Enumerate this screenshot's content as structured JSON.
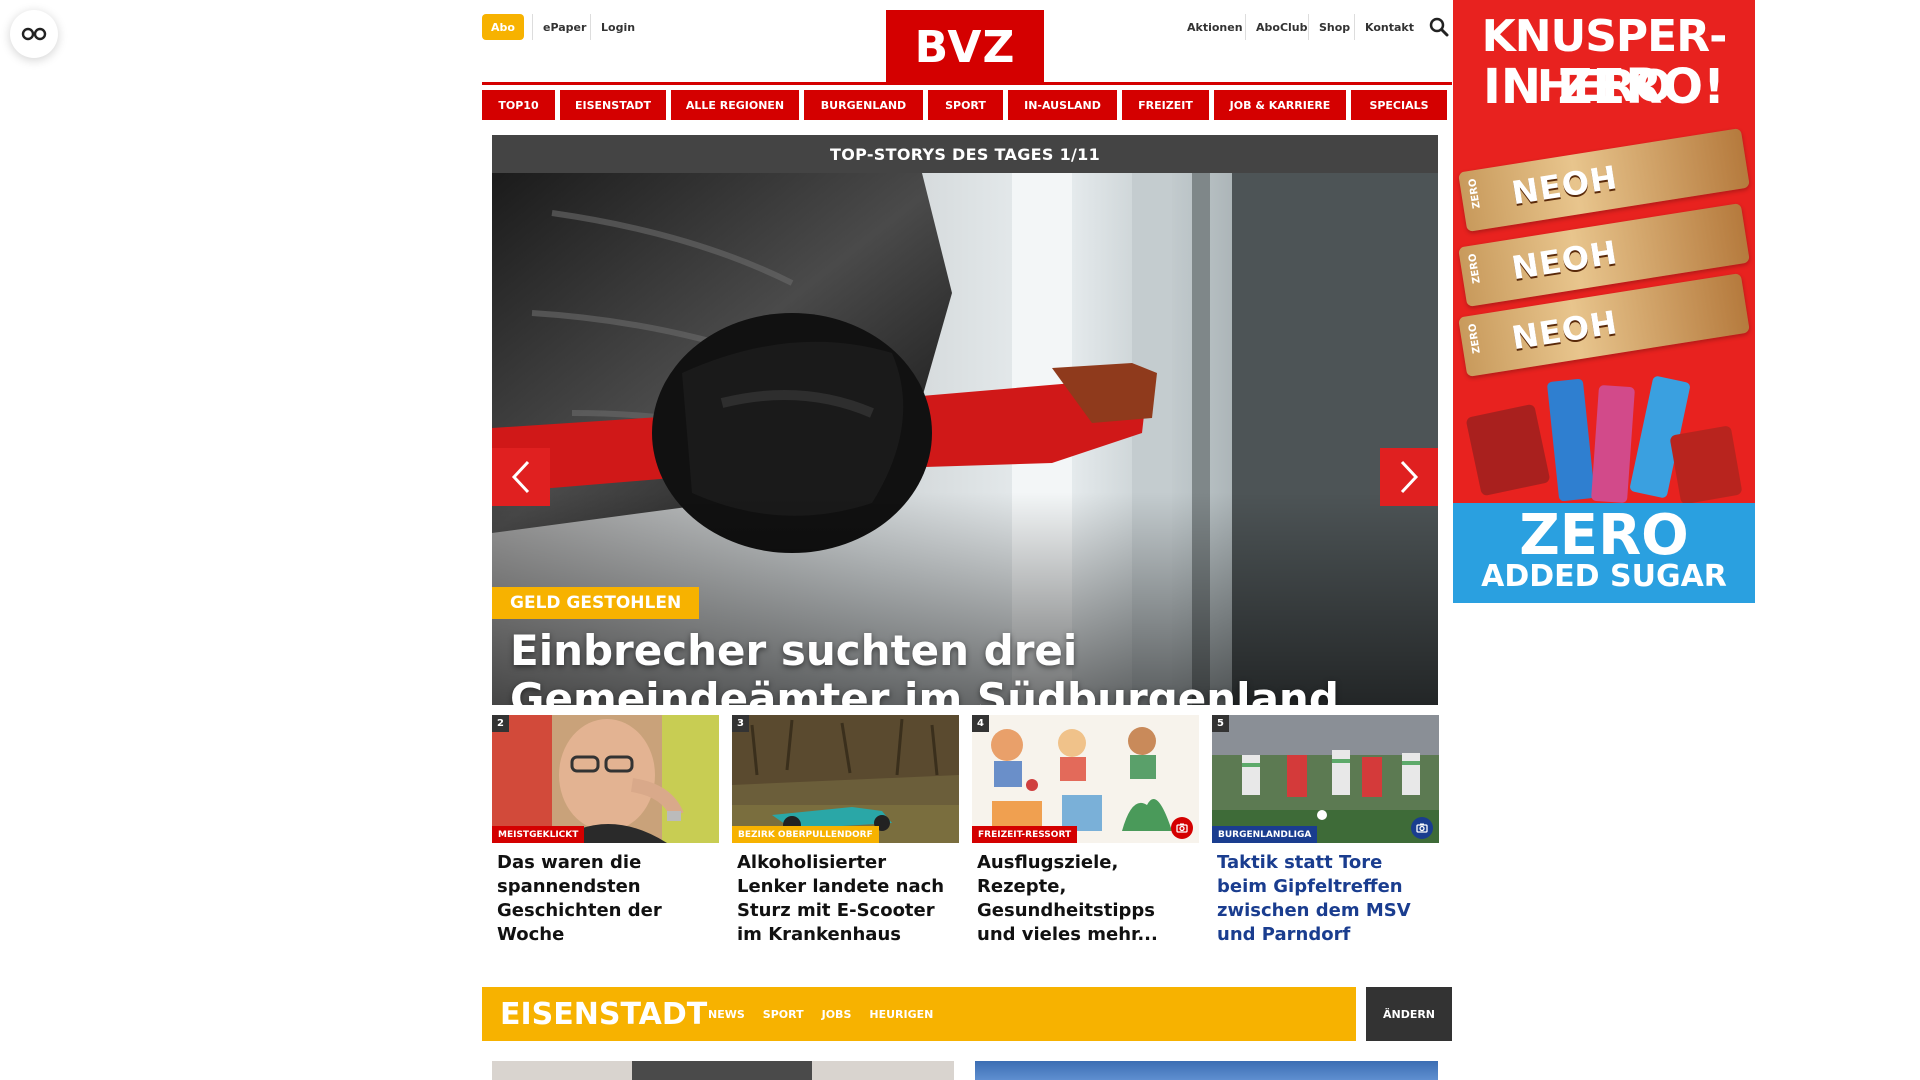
{
  "topbar": {
    "abo": "Abo",
    "links_left": [
      "ePaper",
      "Login"
    ],
    "logo": "BVZ",
    "links_right": [
      "Aktionen",
      "AboClub",
      "Shop",
      "Kontakt"
    ]
  },
  "nav": [
    "TOP10",
    "EISENSTADT",
    "ALLE REGIONEN",
    "BURGENLAND",
    "SPORT",
    "IN-AUSLAND",
    "FREIZEIT",
    "JOB & KARRIERE",
    "SPECIALS"
  ],
  "hero": {
    "header": "TOP-STORYS DES TAGES 1/11",
    "tag": "GELD GESTOHLEN",
    "title": "Einbrecher suchten drei Gemeindeämter im Südburgenland heim"
  },
  "teasers": [
    {
      "num": "2",
      "category": "MEISTGEKLICKT",
      "category_color": "#d40000",
      "title": "Das waren die spannendsten Geschichten der Woche"
    },
    {
      "num": "3",
      "category": "BEZIRK OBERPULLENDORF",
      "category_color": "#f7b200",
      "title": "Alkoholisierter Lenker landete nach Sturz mit E-Scooter im Krankenhaus"
    },
    {
      "num": "4",
      "category": "FREIZEIT-RESSORT",
      "category_color": "#d40000",
      "title": "Ausflugsziele, Rezepte, Gesundheitstipps und vieles mehr..."
    },
    {
      "num": "5",
      "category": "BURGENLANDLIGA",
      "category_color": "#1a3d8f",
      "title": "Taktik statt Tore beim Gipfeltreffen zwischen dem MSV und Parndorf"
    }
  ],
  "section": {
    "name": "EISENSTADT",
    "links": [
      "NEWS",
      "SPORT",
      "JOBS",
      "HEURIGEN"
    ],
    "change": "ÄNDERN"
  },
  "ad": {
    "line1": "KNUSPER-HERO",
    "line2": "IN ZERO!",
    "brand": "NEOH",
    "zero": "ZERO",
    "sugar": "ADDED SUGAR"
  },
  "colors": {
    "brand_red": "#d40000",
    "accent_yellow": "#f7b200",
    "sport_blue": "#1a3d8f"
  }
}
